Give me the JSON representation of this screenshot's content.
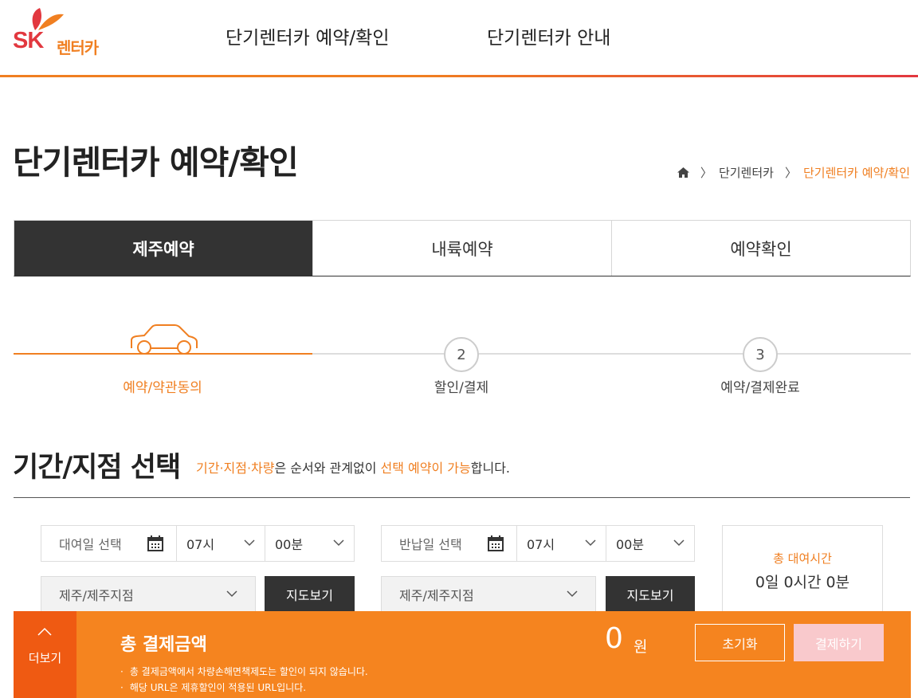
{
  "header": {
    "logo_mark": "SK",
    "logo_word": "렌터카",
    "nav": [
      "단기렌터카 예약/확인",
      "단기렌터카 안내"
    ]
  },
  "page": {
    "title": "단기렌터카 예약/확인",
    "breadcrumb": [
      "단기렌터카",
      "단기렌터카 예약/확인"
    ]
  },
  "tabs": [
    {
      "label": "제주예약",
      "active": true
    },
    {
      "label": "내륙예약",
      "active": false
    },
    {
      "label": "예약확인",
      "active": false
    }
  ],
  "steps": [
    {
      "number": "1",
      "label": "예약/약관동의",
      "icon": "car-icon",
      "active": true
    },
    {
      "number": "2",
      "label": "할인/결제",
      "active": false
    },
    {
      "number": "3",
      "label": "예약/결제완료",
      "active": false
    }
  ],
  "section": {
    "title": "기간/지점 선택",
    "desc_1": "기간·지점·차량",
    "desc_2": "은 순서와 관계없이 ",
    "desc_3": "선택 예약이 가능",
    "desc_4": "합니다."
  },
  "rental": {
    "date_placeholder": "대여일 선택",
    "hour": "07시",
    "minute": "00분",
    "branch": "제주/제주지점",
    "map_button": "지도보기"
  },
  "return": {
    "date_placeholder": "반납일 선택",
    "hour": "07시",
    "minute": "00분",
    "branch": "제주/제주지점",
    "map_button": "지도보기"
  },
  "total_time": {
    "label": "총 대여시간",
    "value": "0일 0시간 0분"
  },
  "bottom_bar": {
    "more_label": "더보기",
    "title": "총 결제금액",
    "notes": [
      "총 결제금액에서 차량손해면책제도는 할인이 되지 않습니다.",
      "해당 URL은 제휴할인이 적용된 URL입니다."
    ],
    "amount": "0",
    "currency": "원",
    "reset_button": "초기화",
    "pay_button": "결제하기"
  },
  "colors": {
    "accent": "#f07f21",
    "brand_red": "#e2383f",
    "bar": "#f5841f",
    "dark": "#333333"
  }
}
